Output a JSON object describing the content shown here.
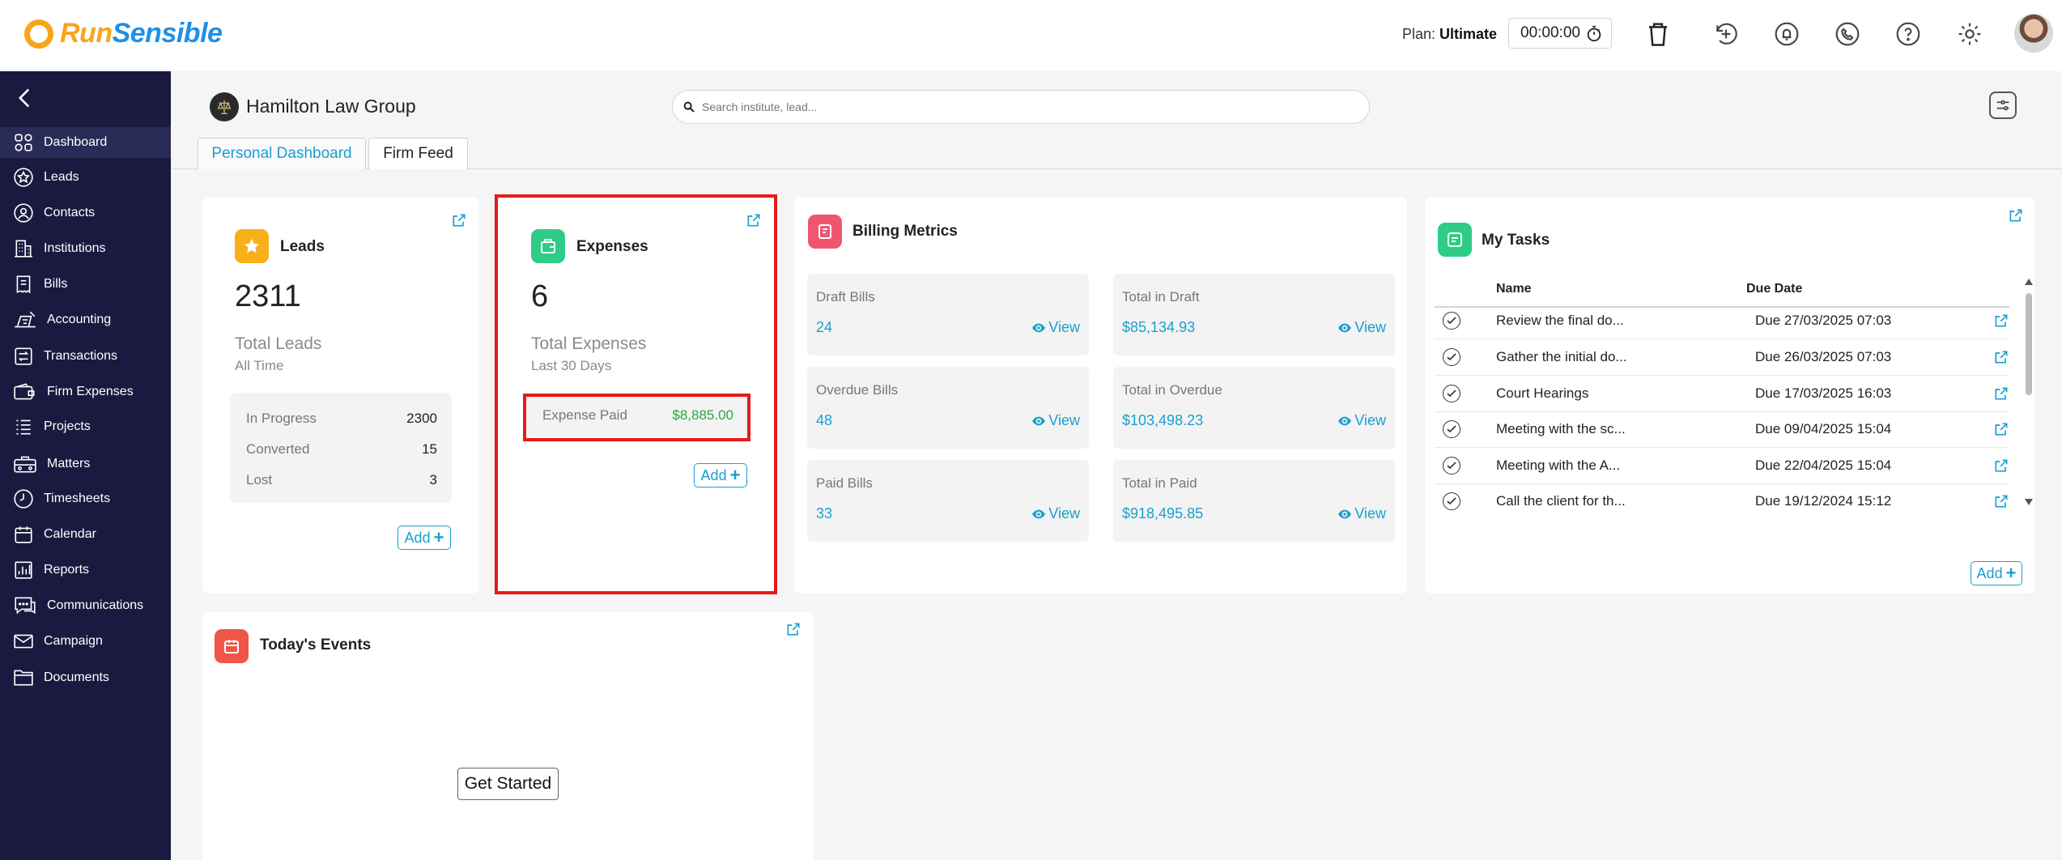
{
  "app": {
    "brand_part1": "Run",
    "brand_part2": "Sensible"
  },
  "topbar": {
    "plan_label": "Plan:",
    "plan_value": "Ultimate",
    "timer": "00:00:00",
    "icons": [
      "trash-icon",
      "add-time-icon",
      "bell-icon",
      "phone-icon",
      "help-icon",
      "gear-icon"
    ]
  },
  "sidebar": {
    "items": [
      {
        "label": "Dashboard",
        "icon": "dashboard-icon",
        "active": true
      },
      {
        "label": "Leads",
        "icon": "star-icon"
      },
      {
        "label": "Contacts",
        "icon": "person-icon"
      },
      {
        "label": "Institutions",
        "icon": "building-icon"
      },
      {
        "label": "Bills",
        "icon": "bill-icon"
      },
      {
        "label": "Accounting",
        "icon": "accounting-icon"
      },
      {
        "label": "Transactions",
        "icon": "transactions-icon"
      },
      {
        "label": "Firm Expenses",
        "icon": "wallet-icon"
      },
      {
        "label": "Projects",
        "icon": "list-icon"
      },
      {
        "label": "Matters",
        "icon": "briefcase-icon"
      },
      {
        "label": "Timesheets",
        "icon": "clock-icon"
      },
      {
        "label": "Calendar",
        "icon": "calendar-icon"
      },
      {
        "label": "Reports",
        "icon": "reports-icon"
      },
      {
        "label": "Communications",
        "icon": "chat-icon"
      },
      {
        "label": "Campaign",
        "icon": "mail-icon"
      },
      {
        "label": "Documents",
        "icon": "folder-icon"
      }
    ]
  },
  "header": {
    "firm_name": "Hamilton Law Group",
    "search_placeholder": "Search institute, lead..."
  },
  "tabs": [
    {
      "label": "Personal Dashboard",
      "active": true
    },
    {
      "label": "Firm Feed",
      "active": false
    }
  ],
  "leads_card": {
    "title": "Leads",
    "count": "2311",
    "subtitle": "Total Leads",
    "period": "All Time",
    "rows": [
      {
        "label": "In Progress",
        "value": "2300"
      },
      {
        "label": "Converted",
        "value": "15"
      },
      {
        "label": "Lost",
        "value": "3"
      }
    ],
    "add_label": "Add"
  },
  "expenses_card": {
    "title": "Expenses",
    "count": "6",
    "subtitle": "Total Expenses",
    "period": "Last 30 Days",
    "paid_label": "Expense Paid",
    "paid_value": "$8,885.00",
    "add_label": "Add"
  },
  "billing_card": {
    "title": "Billing Metrics",
    "view_label": "View",
    "metrics": [
      {
        "label": "Draft Bills",
        "value": "24"
      },
      {
        "label": "Total in Draft",
        "value": "$85,134.93"
      },
      {
        "label": "Overdue Bills",
        "value": "48"
      },
      {
        "label": "Total in Overdue",
        "value": "$103,498.23"
      },
      {
        "label": "Paid Bills",
        "value": "33"
      },
      {
        "label": "Total in Paid",
        "value": "$918,495.85"
      }
    ]
  },
  "tasks_card": {
    "title": "My Tasks",
    "col_name": "Name",
    "col_due": "Due Date",
    "tasks": [
      {
        "name": "Review the final do...",
        "due": "Due 27/03/2025 07:03"
      },
      {
        "name": "Gather the initial do...",
        "due": "Due 26/03/2025 07:03"
      },
      {
        "name": "Court Hearings",
        "due": "Due 17/03/2025 16:03"
      },
      {
        "name": "Meeting with the sc...",
        "due": "Due 09/04/2025 15:04"
      },
      {
        "name": "Meeting with the A...",
        "due": "Due 22/04/2025 15:04"
      },
      {
        "name": "Call the client for th...",
        "due": "Due 19/12/2024 15:12"
      }
    ],
    "add_label": "Add"
  },
  "events_card": {
    "title": "Today's Events",
    "get_started_label": "Get Started"
  },
  "colors": {
    "accent": "#1a9fd1",
    "sidebar_bg": "#1a1a40",
    "highlight": "#e41b1b",
    "expense_green": "#27a844",
    "brand_orange": "#f7a51c",
    "brand_blue": "#1f8fe6"
  }
}
